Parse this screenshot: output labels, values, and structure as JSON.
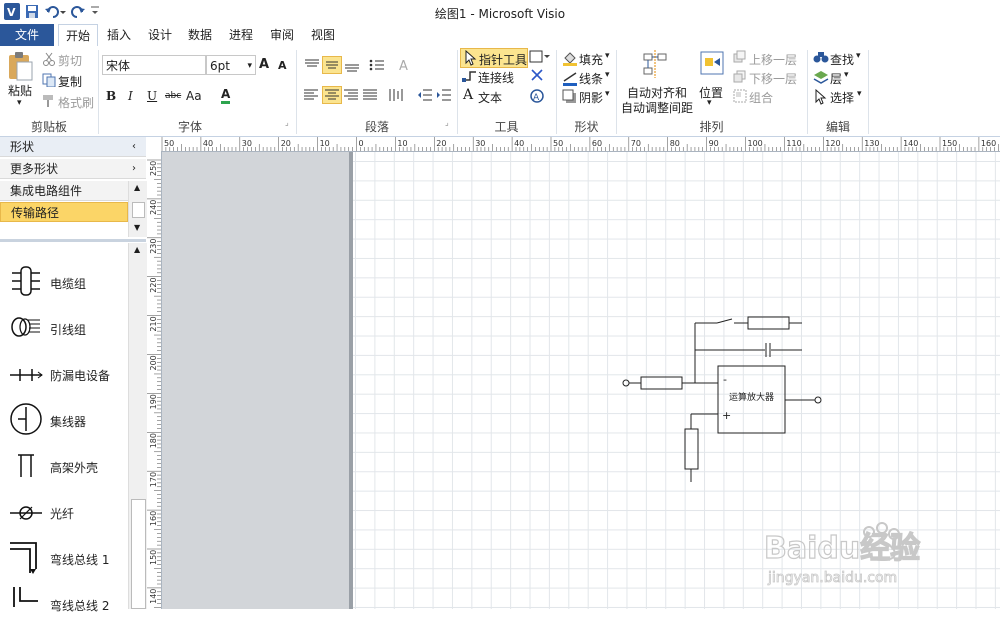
{
  "window": {
    "title": "绘图1 - Microsoft Visio"
  },
  "tabs": [
    {
      "label": "文件"
    },
    {
      "label": "开始"
    },
    {
      "label": "插入"
    },
    {
      "label": "设计"
    },
    {
      "label": "数据"
    },
    {
      "label": "进程"
    },
    {
      "label": "审阅"
    },
    {
      "label": "视图"
    }
  ],
  "ribbon": {
    "clipboard": {
      "paste": "粘贴",
      "cut": "剪切",
      "copy": "复制",
      "format_painter": "格式刷",
      "group": "剪贴板"
    },
    "font": {
      "font_name": "宋体",
      "font_size": "6pt",
      "bold": "B",
      "italic": "I",
      "underline": "U",
      "strike": "abc",
      "case": "Aa",
      "color": "A",
      "grow": "A",
      "shrink": "A",
      "group": "字体"
    },
    "paragraph": {
      "group": "段落"
    },
    "tools": {
      "pointer": "指针工具",
      "connector": "连接线",
      "text": "文本",
      "group": "工具"
    },
    "shape": {
      "fill": "填充",
      "line": "线条",
      "shadow": "阴影",
      "group": "形状"
    },
    "arrange": {
      "auto_align": "自动对齐和",
      "auto_space": "自动调整间距",
      "position": "位置",
      "bring_forward": "上移一层",
      "send_backward": "下移一层",
      "group_cmd": "组合",
      "group": "排列"
    },
    "editing": {
      "find": "查找",
      "layers": "层",
      "select": "选择",
      "group": "编辑"
    }
  },
  "shapes_panel": {
    "title": "形状",
    "more_shapes": "更多形状",
    "stencils": [
      "集成电路组件",
      "传输路径"
    ],
    "items": [
      "电缆组",
      "引线组",
      "防漏电设备",
      "集线器",
      "高架外壳",
      "光纤",
      "弯线总线 1",
      "弯线总线 2"
    ]
  },
  "rulers": {
    "horizontal": [
      "50",
      "40",
      "30",
      "20",
      "10",
      "0",
      "10",
      "20",
      "30",
      "40",
      "50",
      "60",
      "70",
      "80",
      "90",
      "100",
      "110",
      "120",
      "130",
      "140",
      "150",
      "160"
    ],
    "vertical": [
      "250",
      "240",
      "230",
      "220",
      "210",
      "200",
      "190",
      "180",
      "170",
      "160",
      "150",
      "140"
    ]
  },
  "diagram": {
    "opamp_label": "运算放大器",
    "minus": "-",
    "plus": "+"
  },
  "watermark": {
    "text": "Baidu经验",
    "sub": "jingyan.baidu.com"
  },
  "colors": {
    "file_tab": "#2b579a",
    "highlight": "#fbe48f",
    "grid": "#e2e6ea",
    "canvas_gray": "#d2d5d9"
  }
}
